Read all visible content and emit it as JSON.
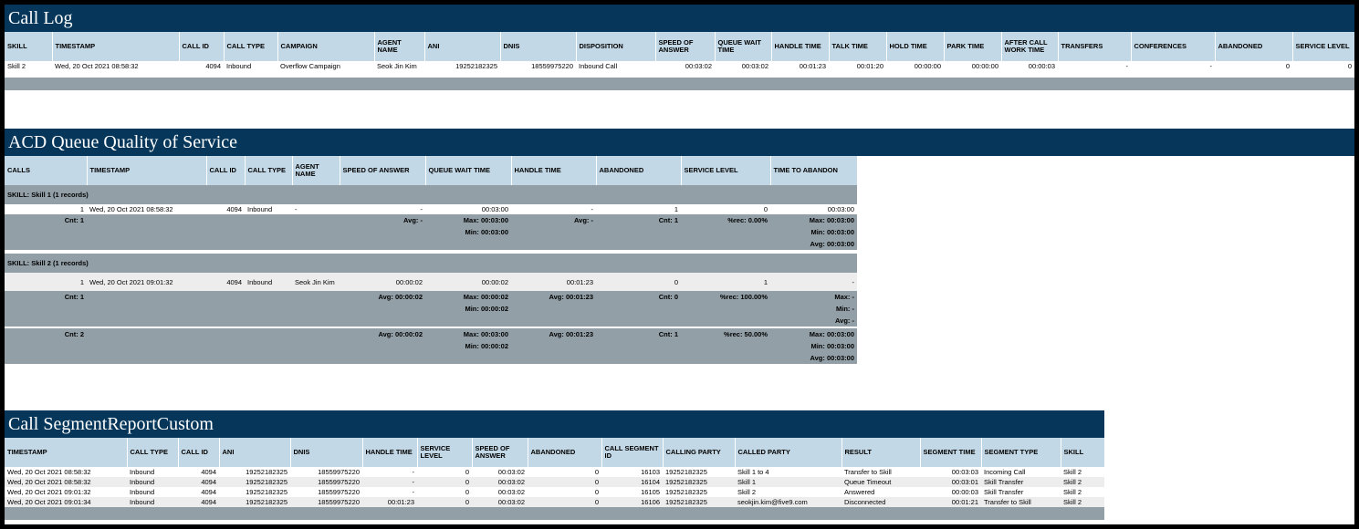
{
  "call_log": {
    "title": "Call Log",
    "headers": [
      "SKILL",
      "TIMESTAMP",
      "CALL ID",
      "CALL TYPE",
      "CAMPAIGN",
      "AGENT NAME",
      "ANI",
      "DNIS",
      "DISPOSITION",
      "SPEED OF ANSWER",
      "QUEUE WAIT TIME",
      "HANDLE TIME",
      "TALK TIME",
      "HOLD TIME",
      "PARK TIME",
      "AFTER CALL WORK TIME",
      "TRANSFERS",
      "CONFERENCES",
      "ABANDONED",
      "SERVICE LEVEL"
    ],
    "row": [
      "Skill 2",
      "Wed, 20 Oct 2021 08:58:32",
      "4094",
      "Inbound",
      "Overflow Campaign",
      "Seok Jin Kim",
      "19252182325",
      "18559975220",
      "Inbound Call",
      "00:03:02",
      "00:03:02",
      "00:01:23",
      "00:01:20",
      "00:00:00",
      "00:00:00",
      "00:00:03",
      "-",
      "-",
      "0",
      "0"
    ]
  },
  "acd": {
    "title": "ACD Queue Quality of Service",
    "headers": [
      "CALLS",
      "TIMESTAMP",
      "CALL ID",
      "CALL TYPE",
      "AGENT NAME",
      "SPEED OF ANSWER",
      "QUEUE WAIT TIME",
      "HANDLE TIME",
      "ABANDONED",
      "SERVICE LEVEL",
      "TIME TO ABANDON"
    ],
    "group1": {
      "label": "SKILL: Skill 1 (1 records)",
      "row": [
        "1",
        "Wed, 20 Oct 2021 08:58:32",
        "4094",
        "Inbound",
        "-",
        "-",
        "00:03:00",
        "-",
        "1",
        "0",
        "00:03:00"
      ],
      "cnt": "Cnt: 1",
      "soa_avg": "Avg: -",
      "qwt_max": "Max: 00:03:00",
      "qwt_min": "Min: 00:03:00",
      "ht_avg": "Avg: -",
      "ab_cnt": "Cnt: 1",
      "sl_rec": "%rec: 0.00%",
      "tta_max": "Max: 00:03:00",
      "tta_min": "Min: 00:03:00",
      "tta_avg": "Avg: 00:03:00"
    },
    "group2": {
      "label": "SKILL: Skill 2 (1 records)",
      "row": [
        "1",
        "Wed, 20 Oct 2021 09:01:32",
        "4094",
        "Inbound",
        "Seok Jin Kim",
        "00:00:02",
        "00:00:02",
        "00:01:23",
        "0",
        "1",
        "-"
      ],
      "cnt": "Cnt: 1",
      "soa_avg": "Avg: 00:00:02",
      "qwt_max": "Max: 00:00:02",
      "qwt_min": "Min: 00:00:02",
      "ht_avg": "Avg: 00:01:23",
      "ab_cnt": "Cnt: 0",
      "sl_rec": "%rec: 100.00%",
      "tta_max": "Max: -",
      "tta_min": "Min: -",
      "tta_avg": "Avg: -"
    },
    "total": {
      "cnt": "Cnt: 2",
      "soa_avg": "Avg: 00:00:02",
      "qwt_max": "Max: 00:03:00",
      "qwt_min": "Min: 00:00:02",
      "ht_avg": "Avg: 00:01:23",
      "ab_cnt": "Cnt: 1",
      "sl_rec": "%rec: 50.00%",
      "tta_max": "Max: 00:03:00",
      "tta_min": "Min: 00:03:00",
      "tta_avg": "Avg: 00:03:00"
    }
  },
  "segment": {
    "title": "Call SegmentReportCustom",
    "headers": [
      "TIMESTAMP",
      "CALL TYPE",
      "CALL ID",
      "ANI",
      "DNIS",
      "HANDLE TIME",
      "SERVICE LEVEL",
      "SPEED OF ANSWER",
      "ABANDONED",
      "CALL SEGMENT ID",
      "CALLING PARTY",
      "CALLED PARTY",
      "RESULT",
      "SEGMENT TIME",
      "SEGMENT TYPE",
      "SKILL"
    ],
    "rows": [
      [
        "Wed, 20 Oct 2021 08:58:32",
        "Inbound",
        "4094",
        "19252182325",
        "18559975220",
        "-",
        "0",
        "00:03:02",
        "0",
        "16103",
        "19252182325",
        "Skill 1 to 4",
        "Transfer to Skill",
        "00:03:03",
        "Incoming Call",
        "Skill 2"
      ],
      [
        "Wed, 20 Oct 2021 08:58:32",
        "Inbound",
        "4094",
        "19252182325",
        "18559975220",
        "-",
        "0",
        "00:03:02",
        "0",
        "16104",
        "19252182325",
        "Skill 1",
        "Queue Timeout",
        "00:03:01",
        "Skill Transfer",
        "Skill 2"
      ],
      [
        "Wed, 20 Oct 2021 09:01:32",
        "Inbound",
        "4094",
        "19252182325",
        "18559975220",
        "-",
        "0",
        "00:03:02",
        "0",
        "16105",
        "19252182325",
        "Skill 2",
        "Answered",
        "00:00:03",
        "Skill Transfer",
        "Skill 2"
      ],
      [
        "Wed, 20 Oct 2021 09:01:34",
        "Inbound",
        "4094",
        "19252182325",
        "18559975220",
        "00:01:23",
        "0",
        "00:03:02",
        "0",
        "16106",
        "19252182325",
        "seokjin.kim@five9.com",
        "Disconnected",
        "00:01:21",
        "Transfer to Skill",
        "Skill 2"
      ]
    ]
  }
}
